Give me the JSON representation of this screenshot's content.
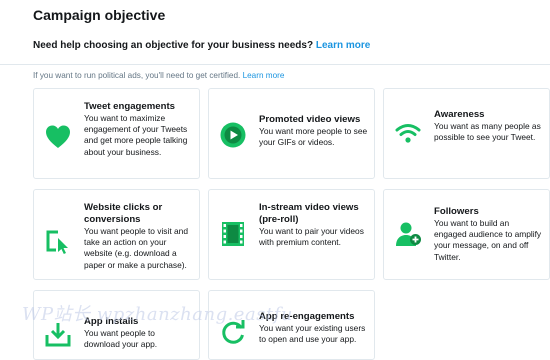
{
  "page": {
    "title": "Campaign objective",
    "help_text": "Need help choosing an objective for your business needs?",
    "help_link": "Learn more",
    "political_text": "If you want to run political ads, you'll need to get certified.",
    "political_link": "Learn more"
  },
  "objectives": [
    {
      "title": "Tweet engagements",
      "desc": "You want to maximize engagement of your Tweets and get more people talking about your business.",
      "icon": "heart-icon"
    },
    {
      "title": "Promoted video views",
      "desc": "You want more people to see your GIFs or videos.",
      "icon": "play-icon"
    },
    {
      "title": "Awareness",
      "desc": "You want as many people as possible to see your Tweet.",
      "icon": "wifi-icon"
    },
    {
      "title": "Website clicks or conversions",
      "desc": "You want people to visit and take an action on your website (e.g. download a paper or make a purchase).",
      "icon": "cursor-click-icon"
    },
    {
      "title": "In-stream video views (pre-roll)",
      "desc": "You want to pair your videos with premium content.",
      "icon": "film-icon"
    },
    {
      "title": "Followers",
      "desc": "You want to build an engaged audience to amplify your message, on and off Twitter.",
      "icon": "add-follower-icon"
    },
    {
      "title": "App installs",
      "desc": "You want people to download your app.",
      "icon": "download-icon"
    },
    {
      "title": "App re-engagements",
      "desc": "You want your existing users to open and use your app.",
      "icon": "refresh-icon"
    }
  ],
  "watermark": "WP站长 wpzhanzhang.eastfu",
  "colors": {
    "accent_green": "#17bf63",
    "dark_green": "#0e8a43",
    "link_blue": "#1b95e0",
    "border": "#e1e8ed"
  }
}
